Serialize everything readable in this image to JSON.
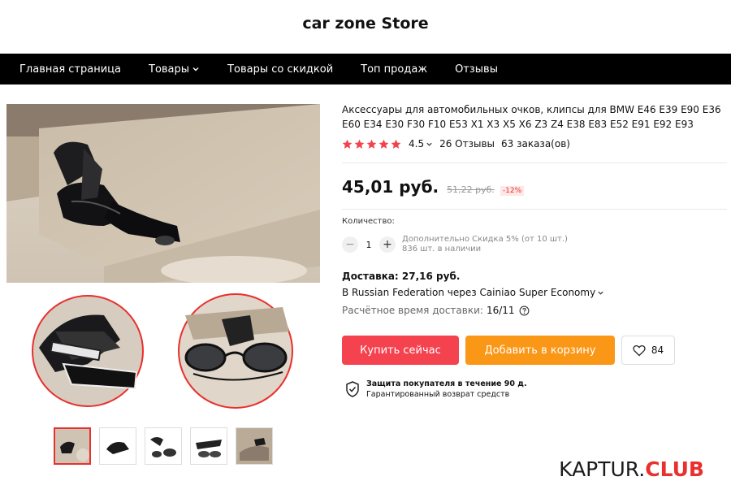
{
  "store": {
    "name": "car zone Store"
  },
  "nav": {
    "items": [
      {
        "label": "Главная страница",
        "has_dropdown": false
      },
      {
        "label": "Товары",
        "has_dropdown": true
      },
      {
        "label": "Товары со скидкой",
        "has_dropdown": false
      },
      {
        "label": "Топ продаж",
        "has_dropdown": false
      },
      {
        "label": "Отзывы",
        "has_dropdown": false
      }
    ]
  },
  "gallery": {
    "thumbnail_count": 5,
    "active_index": 0
  },
  "product": {
    "title": "Аксессуары для автомобильных очков, клипсы для BMW E46 E39 E90 E36 E60 E34 E30 F30 F10 E53 X1 X3 X5 X6 Z3 Z4 E38 E83 E52 E91 E92 E93",
    "rating": "4.5",
    "stars": 5,
    "reviews": "26 Отзывы",
    "orders": "63 заказа(ов)",
    "price": "45,01 руб.",
    "old_price": "51,22 руб.",
    "discount": "-12%"
  },
  "quantity": {
    "label": "Количество:",
    "value": "1",
    "minus": "−",
    "plus": "+",
    "discount_note": "Дополнительно Скидка 5% (от 10 шт.)",
    "stock_note": "836 шт. в наличии"
  },
  "shipping": {
    "title": "Доставка: 27,16 руб.",
    "route": "В Russian Federation через Cainiao Super Economy",
    "time_label": "Расчётное время доставки:",
    "time_value": "16/11"
  },
  "actions": {
    "buy_now": "Купить сейчас",
    "add_to_cart": "Добавить в корзину",
    "wishlist_count": "84"
  },
  "protection": {
    "title": "Защита покупателя в течение 90 д.",
    "subtitle": "Гарантированный возврат средств"
  },
  "watermark": {
    "part1": "KAPTUR.",
    "part2": "CLUB"
  },
  "colors": {
    "accent_red": "#f5424f",
    "accent_orange": "#fb9717",
    "nav_bg": "#000000",
    "star": "#f5424f"
  }
}
